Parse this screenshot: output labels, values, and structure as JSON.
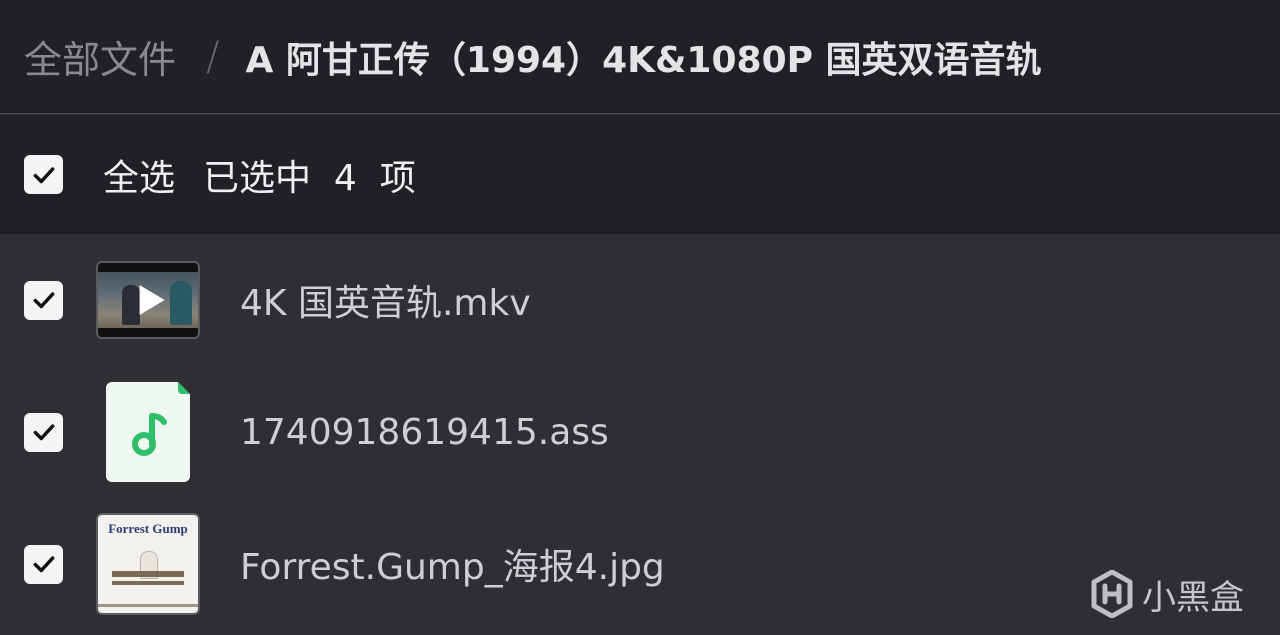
{
  "breadcrumb": {
    "root": "全部文件",
    "separator": "/",
    "current": "A 阿甘正传（1994）4K&1080P 国英双语音轨"
  },
  "selection": {
    "select_all_label": "全选",
    "selected_text": "已选中  4  项",
    "all_checked": true
  },
  "files": [
    {
      "name": "4K 国英音轨.mkv",
      "type": "video",
      "checked": true,
      "thumb_icon": "video-play-icon"
    },
    {
      "name": "1740918619415.ass",
      "type": "audio",
      "checked": true,
      "thumb_icon": "music-note-icon"
    },
    {
      "name": "Forrest.Gump_海报4.jpg",
      "type": "image",
      "checked": true,
      "thumb_icon": "poster-thumbnail",
      "poster_title": "Forrest Gump"
    }
  ],
  "watermark": {
    "label": "小黑盒",
    "icon": "heybox-logo-icon"
  },
  "colors": {
    "background": "#2f2e33",
    "header": "#212025",
    "accent_green": "#2fbf6a",
    "checkbox": "#f5f5f7"
  }
}
